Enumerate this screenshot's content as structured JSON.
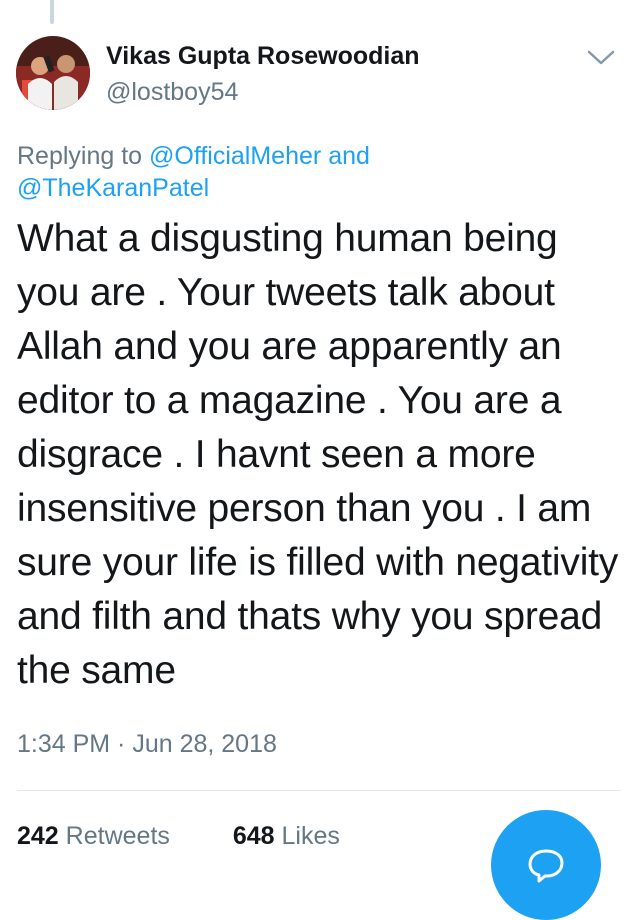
{
  "tweet": {
    "author_name": "Vikas Gupta Rosewoodian",
    "author_handle": "@lostboy54",
    "replying_prefix": "Replying to",
    "reply_mention_1": "@OfficialMeher",
    "reply_joiner": "and",
    "reply_mention_2": "@TheKaranPatel",
    "text": "What a disgusting human being you are . Your tweets talk about Allah and you are apparently an editor to a magazine . You are a disgrace . I havnt seen a more insensitive person than you . I am sure your life is filled with negativity and filth and thats why you spread the same",
    "timestamp": "1:34 PM · Jun 28, 2018",
    "retweets_count": "242",
    "retweets_label": "Retweets",
    "likes_count": "648",
    "likes_label": "Likes"
  },
  "icons": {
    "menu": "chevron-down-icon",
    "compose": "reply-bubble-icon"
  },
  "colors": {
    "link": "#1da1f2",
    "secondary_text": "#657786",
    "primary_text": "#14171a",
    "fab": "#1da1f2"
  }
}
